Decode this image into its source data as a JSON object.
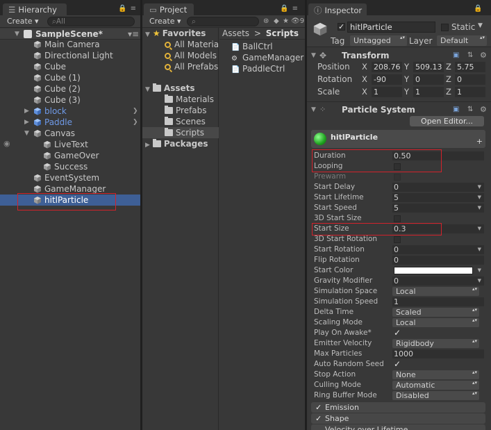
{
  "hierarchy": {
    "tab_label": "Hierarchy",
    "create_label": "Create ▾",
    "search_placeholder": "All",
    "scene_name": "SampleScene*",
    "items": [
      {
        "label": "Main Camera"
      },
      {
        "label": "Directional Light"
      },
      {
        "label": "Cube"
      },
      {
        "label": "Cube (1)"
      },
      {
        "label": "Cube (2)"
      },
      {
        "label": "Cube (3)"
      },
      {
        "label": "block"
      },
      {
        "label": "Paddle"
      },
      {
        "label": "Canvas"
      },
      {
        "label": "LiveText"
      },
      {
        "label": "GameOver"
      },
      {
        "label": "Success"
      },
      {
        "label": "EventSystem"
      },
      {
        "label": "GameManager"
      },
      {
        "label": "hitlParticle"
      }
    ]
  },
  "project": {
    "tab_label": "Project",
    "create_label": "Create ▾",
    "badge_count": "9",
    "favorites_label": "Favorites",
    "favorites": [
      {
        "label": "All Materia"
      },
      {
        "label": "All Models"
      },
      {
        "label": "All Prefabs"
      }
    ],
    "assets_label": "Assets",
    "asset_folders": [
      {
        "label": "Materials"
      },
      {
        "label": "Prefabs"
      },
      {
        "label": "Scenes"
      },
      {
        "label": "Scripts"
      }
    ],
    "packages_label": "Packages",
    "breadcrumb": {
      "root": "Assets",
      "sep": ">",
      "current": "Scripts"
    },
    "files": [
      {
        "label": "BallCtrl"
      },
      {
        "label": "GameManager"
      },
      {
        "label": "PaddleCtrl"
      }
    ]
  },
  "inspector": {
    "tab_label": "Inspector",
    "object_name": "hitlParticle",
    "static_label": "Static",
    "tag_label": "Tag",
    "tag_value": "Untagged",
    "layer_label": "Layer",
    "layer_value": "Default",
    "transform": {
      "title": "Transform",
      "position": {
        "label": "Position",
        "x": "208.76",
        "y": "509.13",
        "z": "5.75"
      },
      "rotation": {
        "label": "Rotation",
        "x": "-90",
        "y": "0",
        "z": "0"
      },
      "scale": {
        "label": "Scale",
        "x": "1",
        "y": "1",
        "z": "1"
      }
    },
    "particle_system": {
      "title": "Particle System",
      "open_editor": "Open Editor...",
      "sub_name": "hitlParticle",
      "rows": {
        "duration": {
          "label": "Duration",
          "value": "0.50"
        },
        "looping": {
          "label": "Looping"
        },
        "prewarm": {
          "label": "Prewarm"
        },
        "start_delay": {
          "label": "Start Delay",
          "value": "0"
        },
        "start_lifetime": {
          "label": "Start Lifetime",
          "value": "5"
        },
        "start_speed": {
          "label": "Start Speed",
          "value": "5"
        },
        "start_size_3d": {
          "label": "3D Start Size"
        },
        "start_size": {
          "label": "Start Size",
          "value": "0.3"
        },
        "start_rotation_3d": {
          "label": "3D Start Rotation"
        },
        "start_rotation": {
          "label": "Start Rotation",
          "value": "0"
        },
        "flip_rotation": {
          "label": "Flip Rotation",
          "value": "0"
        },
        "start_color": {
          "label": "Start Color",
          "color": "#ffffff"
        },
        "gravity": {
          "label": "Gravity Modifier",
          "value": "0"
        },
        "sim_space": {
          "label": "Simulation Space",
          "value": "Local"
        },
        "sim_speed": {
          "label": "Simulation Speed",
          "value": "1"
        },
        "delta_time": {
          "label": "Delta Time",
          "value": "Scaled"
        },
        "scaling_mode": {
          "label": "Scaling Mode",
          "value": "Local"
        },
        "play_on_awake": {
          "label": "Play On Awake*"
        },
        "emitter_velocity": {
          "label": "Emitter Velocity",
          "value": "Rigidbody"
        },
        "max_particles": {
          "label": "Max Particles",
          "value": "1000"
        },
        "auto_random_seed": {
          "label": "Auto Random Seed"
        },
        "stop_action": {
          "label": "Stop Action",
          "value": "None"
        },
        "culling_mode": {
          "label": "Culling Mode",
          "value": "Automatic"
        },
        "ring_buffer": {
          "label": "Ring Buffer Mode",
          "value": "Disabled"
        }
      },
      "modules": [
        {
          "label": "Emission"
        },
        {
          "label": "Shape"
        },
        {
          "label": "Velocity over Lifetime"
        }
      ]
    }
  },
  "colors": {
    "selection": "#3e5f96",
    "highlight_box": "#d3222b",
    "prefab_blue": "#6f9ae8"
  }
}
